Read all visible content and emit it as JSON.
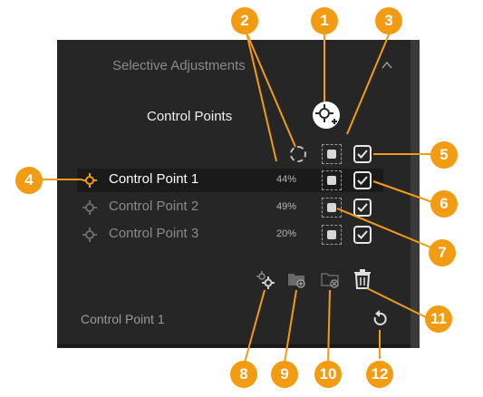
{
  "panel": {
    "section_title": "Selective Adjustments",
    "control_points_title": "Control Points",
    "rows": [
      {
        "label": "Control Point 1",
        "opacity": "44%"
      },
      {
        "label": "Control Point 2",
        "opacity": "49%"
      },
      {
        "label": "Control Point 3",
        "opacity": "20%"
      }
    ],
    "footer_label": "Control Point 1"
  },
  "callouts": [
    "1",
    "2",
    "3",
    "4",
    "5",
    "6",
    "7",
    "8",
    "9",
    "10",
    "11",
    "12"
  ],
  "colors": {
    "accent": "#f39c12",
    "panel_bg": "#262626",
    "selected_row": "#1a1a1a"
  },
  "icons": [
    "add-control-point-icon",
    "collapse-chevron-icon",
    "dashed-circle-icon",
    "mask-icon",
    "checkbox-icon",
    "control-point-icon",
    "duplicate-point-icon",
    "group-icon",
    "ungroup-icon",
    "trash-icon",
    "reset-icon"
  ]
}
